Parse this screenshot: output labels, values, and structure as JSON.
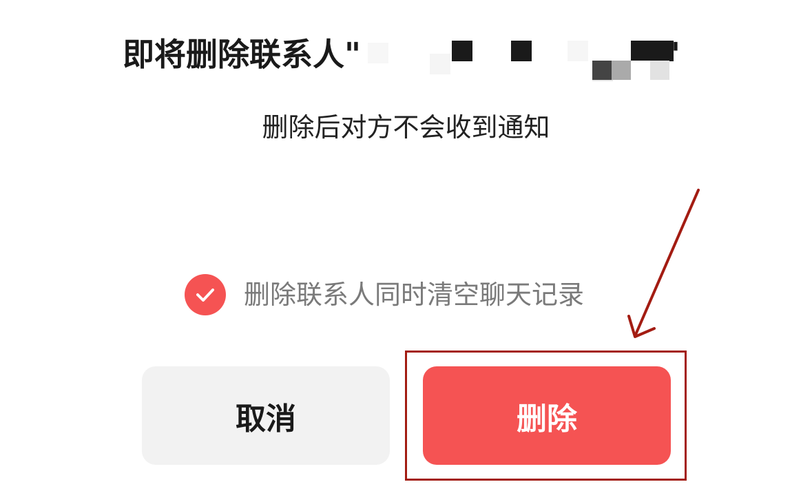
{
  "dialog": {
    "title": "即将删除联系人",
    "open_quote": "\"",
    "close_quote": "\"",
    "subtitle": "删除后对方不会收到通知",
    "checkbox": {
      "label": "删除联系人同时清空聊天记录",
      "checked": true,
      "icon": "checkmark-icon"
    },
    "buttons": {
      "cancel_label": "取消",
      "delete_label": "删除"
    }
  },
  "annotation": {
    "color": "#a31c12"
  },
  "colors": {
    "accent": "#f55353",
    "cancel_bg": "#f2f2f2",
    "title_text": "#1a1a1a",
    "secondary_text": "#7a7a7a"
  }
}
